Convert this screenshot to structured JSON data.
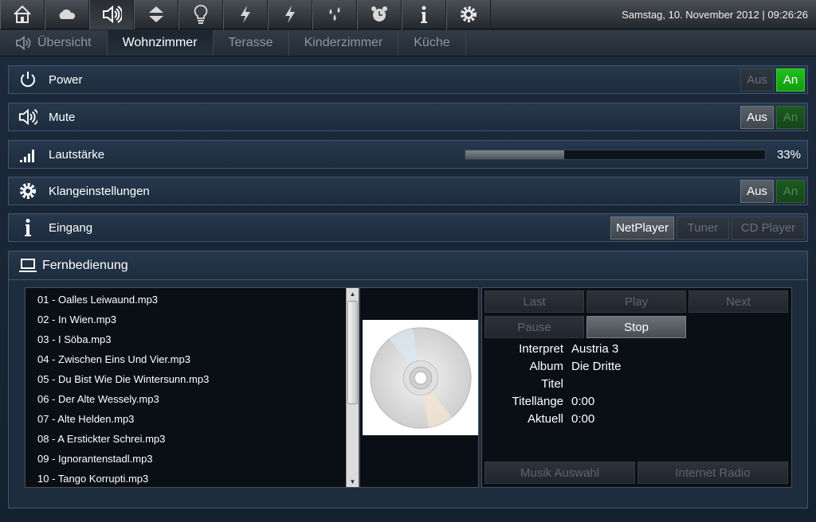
{
  "topbar": {
    "icons": [
      "home-icon",
      "cloud-icon",
      "speaker-icon",
      "up-down-arrows-icon",
      "lightbulb-icon",
      "lightning-icon",
      "lightning-icon",
      "water-drops-icon",
      "alarm-clock-icon",
      "info-icon",
      "gear-icon"
    ],
    "datetime": "Samstag, 10. November 2012 | 09:26:26"
  },
  "tabs": [
    {
      "label": "Übersicht",
      "icon": "speaker-icon"
    },
    {
      "label": "Wohnzimmer",
      "active": true
    },
    {
      "label": "Terasse"
    },
    {
      "label": "Kinderzimmer"
    },
    {
      "label": "Küche"
    }
  ],
  "rows": {
    "power": {
      "label": "Power",
      "icon": "power-icon",
      "off": "Aus",
      "on": "An",
      "state": "An"
    },
    "mute": {
      "label": "Mute",
      "icon": "speaker-icon",
      "off": "Aus",
      "on": "An",
      "state": "Aus"
    },
    "volume": {
      "label": "Lautstärke",
      "icon": "signal-bars-icon",
      "percent_text": "33%",
      "level": 0.33
    },
    "sound": {
      "label": "Klangeinstellungen",
      "icon": "gear-icon",
      "off": "Aus",
      "on": "An",
      "state": "Aus"
    },
    "input": {
      "label": "Eingang",
      "icon": "info-icon",
      "options": [
        "NetPlayer",
        "Tuner",
        "CD Player"
      ],
      "selected": "NetPlayer"
    }
  },
  "remote": {
    "label": "Fernbedienung",
    "icon": "laptop-icon",
    "playlist": [
      "01 - Oalles Leiwaund.mp3",
      "02 - In Wien.mp3",
      "03 - I Söba.mp3",
      "04 - Zwischen Eins Und Vier.mp3",
      "05 - Du Bist Wie Die Wintersunn.mp3",
      "06 - Der Alte Wessely.mp3",
      "07 - Alte Helden.mp3",
      "08 - A Erstickter Schrei.mp3",
      "09 - Ignorantenstadl.mp3",
      "10 - Tango Korrupti.mp3"
    ],
    "buttons": {
      "last": "Last",
      "play": "Play",
      "next": "Next",
      "pause": "Pause",
      "stop": "Stop",
      "musik_auswahl": "Musik Auswahl",
      "internet_radio": "Internet Radio"
    },
    "info": {
      "interpret_label": "Interpret",
      "interpret": "Austria 3",
      "album_label": "Album",
      "album": "Die Dritte",
      "titel_label": "Titel",
      "titel": "",
      "laenge_label": "Titellänge",
      "laenge": "0:00",
      "aktuell_label": "Aktuell",
      "aktuell": "0:00"
    }
  }
}
